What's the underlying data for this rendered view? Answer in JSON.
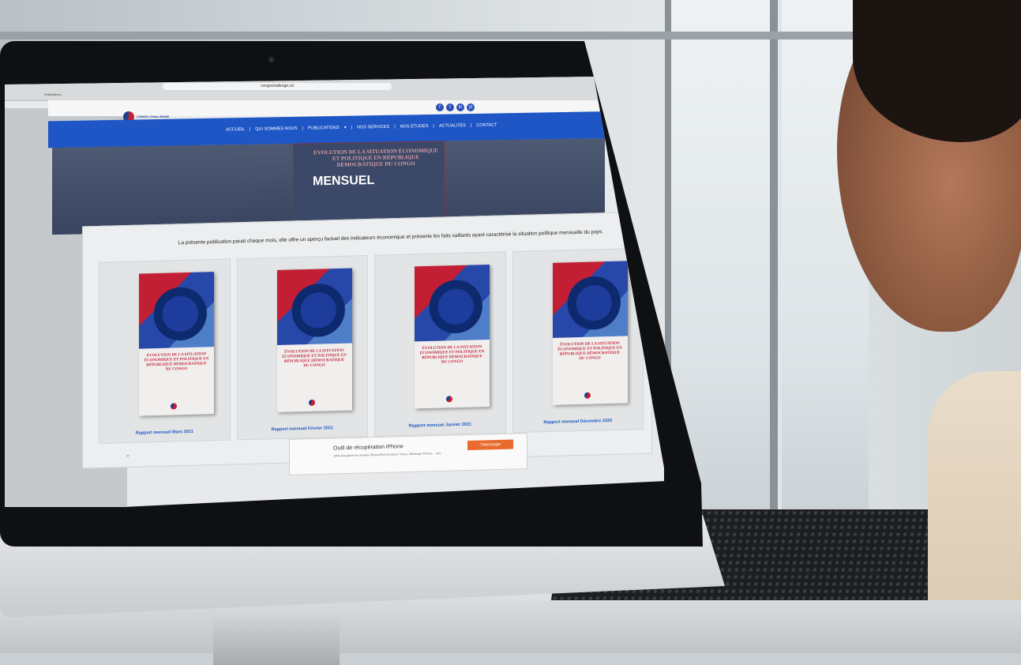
{
  "browser": {
    "url": "congochallenge.cd",
    "tab": "Publications"
  },
  "site": {
    "logo_text": "CONGO CHALLENGE",
    "social": [
      "f",
      "t",
      "in",
      "yt"
    ],
    "nav": [
      "ACCUEIL",
      "QUI SOMMES NOUS",
      "PUBLICATIONS",
      "NOS SERVICES",
      "NOS ÉTUDES",
      "ACTUALITÉS",
      "CONTACT"
    ]
  },
  "hero": {
    "doc_title": "EVOLUTION DE LA SITUATION ÉCONOMIQUE ET POLITIQUE EN RÉPUBLIQUE DÉMOCRATIQUE DU CONGO",
    "label": "MENSUEL"
  },
  "main": {
    "intro": "La présente publication parait chaque mois, elle offre un aperçu factuel des indicateurs économique et présente les faits saillants ayant caractérisé la situation politique mensuelle du pays.",
    "reports": [
      {
        "cover_title": "ÉVOLUTION DE LA SITUATION ÉCONOMIQUE ET POLITIQUE EN RÉPUBLIQUE DÉMOCRATIQUE DU CONGO",
        "label": "Rapport mensuel Mars 2021"
      },
      {
        "cover_title": "ÉVOLUTION DE LA SITUATION ÉCONOMIQUE ET POLITIQUE EN RÉPUBLIQUE DÉMOCRATIQUE DU CONGO",
        "label": "Rapport mensuel Février 2021"
      },
      {
        "cover_title": "ÉVOLUTION DE LA SITUATION ÉCONOMIQUE ET POLITIQUE EN RÉPUBLIQUE DÉMOCRATIQUE DU CONGO",
        "label": "Rapport mensuel Janvier 2021"
      },
      {
        "cover_title": "ÉVOLUTION DE LA SITUATION ÉCONOMIQUE ET POLITIQUE EN RÉPUBLIQUE DÉMOCRATIQUE DU CONGO",
        "label": "Rapport mensuel Décembre 2020"
      }
    ]
  },
  "ad": {
    "title": "Outil de récupération iPhone",
    "description": "100% Récupérer les données iPhone/iPad (Contacts, Textos, Whatsapp, Photos, ... etc)",
    "button": "Télécharger"
  },
  "colors": {
    "nav_blue": "#1f56c6",
    "brand_red": "#c8202f",
    "ad_orange": "#e86a2c"
  }
}
